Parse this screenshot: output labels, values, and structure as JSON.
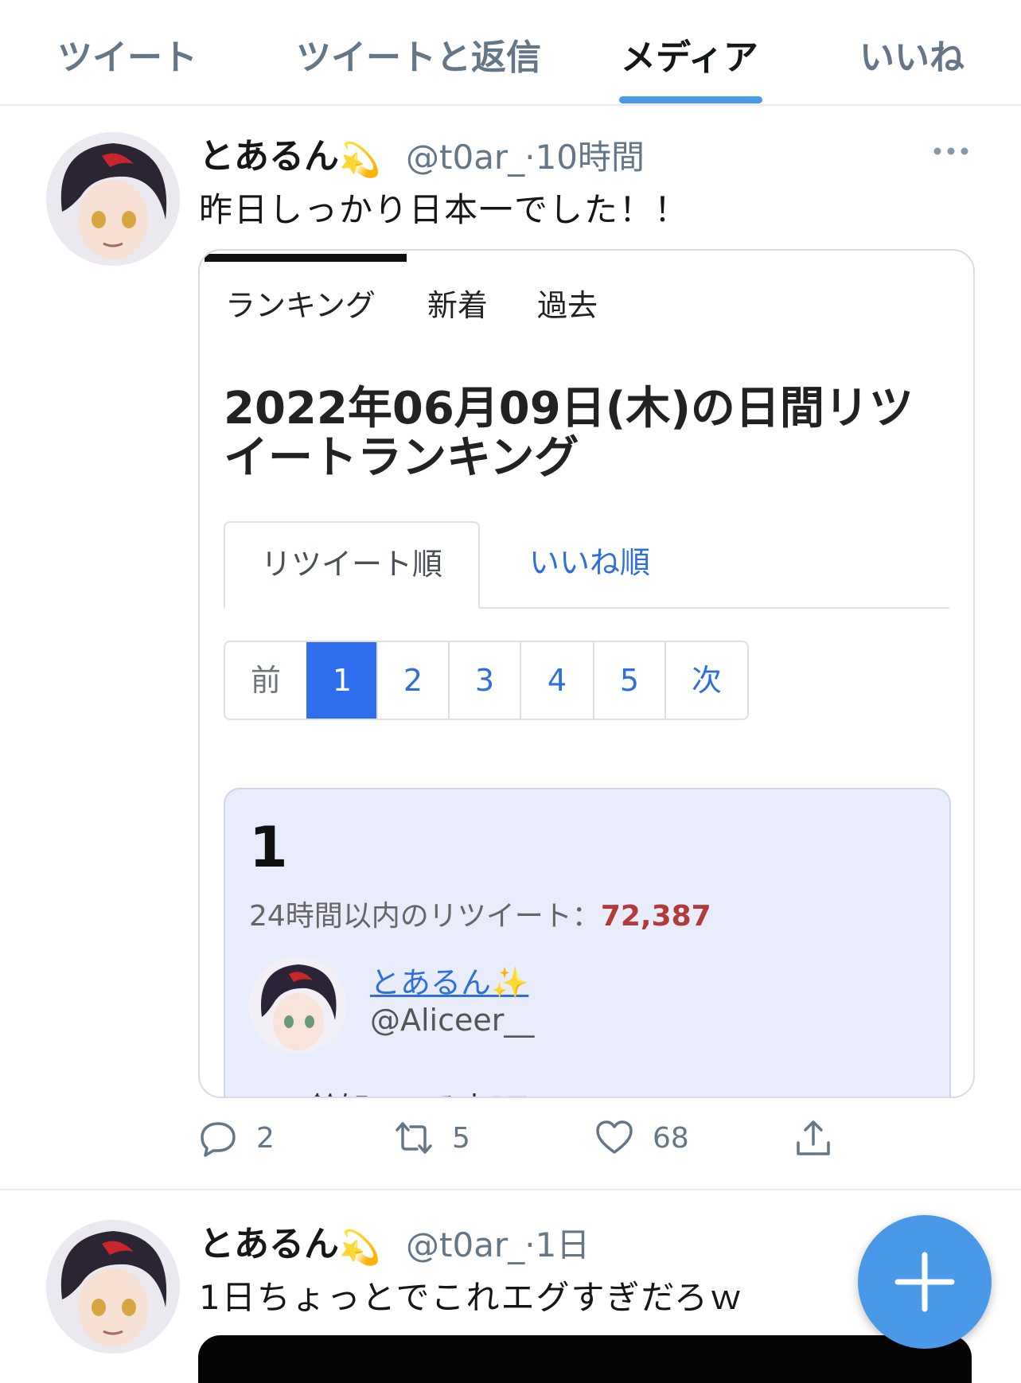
{
  "tabs": {
    "tweets": "ツイート",
    "replies": "ツイートと返信",
    "media": "メディア",
    "likes": "いいね"
  },
  "tweet1": {
    "name": "とあるん",
    "name_emoji": "💫",
    "handle": "@t0ar_",
    "separator": "·",
    "time": "10時間",
    "text": "昨日しっかり日本一でした！！",
    "card": {
      "nav": {
        "ranking": "ランキング",
        "new": "新着",
        "past": "過去"
      },
      "heading": "2022年06月09日(木)の日間リツイートランキング",
      "sort_tabs": {
        "retweet_order": "リツイート順",
        "like_order": "いいね順"
      },
      "pager": {
        "prev": "前",
        "pages": [
          "1",
          "2",
          "3",
          "4",
          "5"
        ],
        "next": "次",
        "current": "1"
      },
      "entry": {
        "rank": "1",
        "label": "24時間以内のリツイート：",
        "count": "72,387",
        "user_name": "とあるん",
        "user_emoji": "✨",
        "user_handle": "@Aliceer__",
        "text_partial": "この鈴知ってる人RT"
      }
    },
    "actions": {
      "replies": "2",
      "retweets": "5",
      "likes": "68"
    }
  },
  "tweet2": {
    "name": "とあるん",
    "name_emoji": "💫",
    "handle": "@t0ar_",
    "separator": "·",
    "time": "1日",
    "text": "1日ちょっとでこれエグすぎだろｗ"
  },
  "colors": {
    "accent": "#4a99e9",
    "link": "#2f6fdb",
    "rank_count": "#b33a3a",
    "page_active": "#2f6fef"
  },
  "icons": [
    "more-icon",
    "reply-icon",
    "retweet-icon",
    "like-icon",
    "share-icon",
    "compose-plus-icon"
  ]
}
